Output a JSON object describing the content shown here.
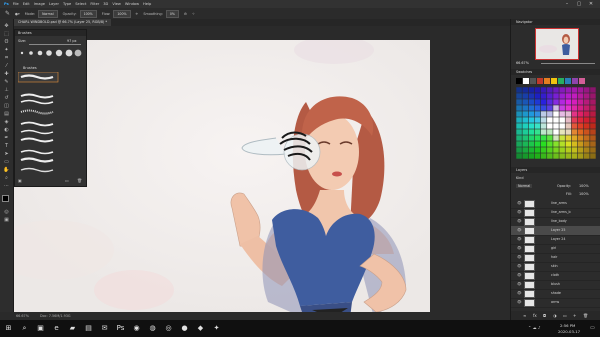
{
  "menu": {
    "items": [
      "File",
      "Edit",
      "Image",
      "Layer",
      "Type",
      "Select",
      "Filter",
      "3D",
      "View",
      "Window",
      "Help"
    ]
  },
  "options": {
    "mode_label": "Mode:",
    "mode_value": "Normal",
    "opacity_label": "Opacity:",
    "opacity_value": "100%",
    "flow_label": "Flow:",
    "flow_value": "100%",
    "smoothing_label": "Smoothing:",
    "smoothing_value": "0%"
  },
  "document": {
    "tab_title": "CHARL WINDBOLD.psd @ 66.7% (Layer 25, RGB/8) *"
  },
  "brushes": {
    "title": "Brushes",
    "size_label": "Size:",
    "size_value": "97 px",
    "group_label": "Brushes"
  },
  "navigator": {
    "title": "Navigator",
    "zoom": "66.67%"
  },
  "swatches": {
    "title": "Swatches"
  },
  "layers": {
    "title": "Layers",
    "kind_label": "Kind",
    "blend_mode": "Normal",
    "opacity_label": "Opacity:",
    "opacity_value": "100%",
    "fill_label": "Fill:",
    "fill_value": "100%",
    "rows": [
      "line_arms",
      "line_arms_b",
      "line_body",
      "Layer 25",
      "Layer 24",
      "girl",
      "hair",
      "skin",
      "cloth",
      "blush",
      "shade",
      "arms"
    ]
  },
  "status": {
    "zoom": "66.67%",
    "doc_size": "Doc: 7.56M/1.93G"
  },
  "taskbar": {
    "time": "2:56 PM",
    "date": "2020-03-17"
  },
  "colors": {
    "accent": "#2e5d8f",
    "canvas_bg": "#f2f1ef",
    "dress": "#3d5a9c",
    "hair": "#b9553d"
  }
}
